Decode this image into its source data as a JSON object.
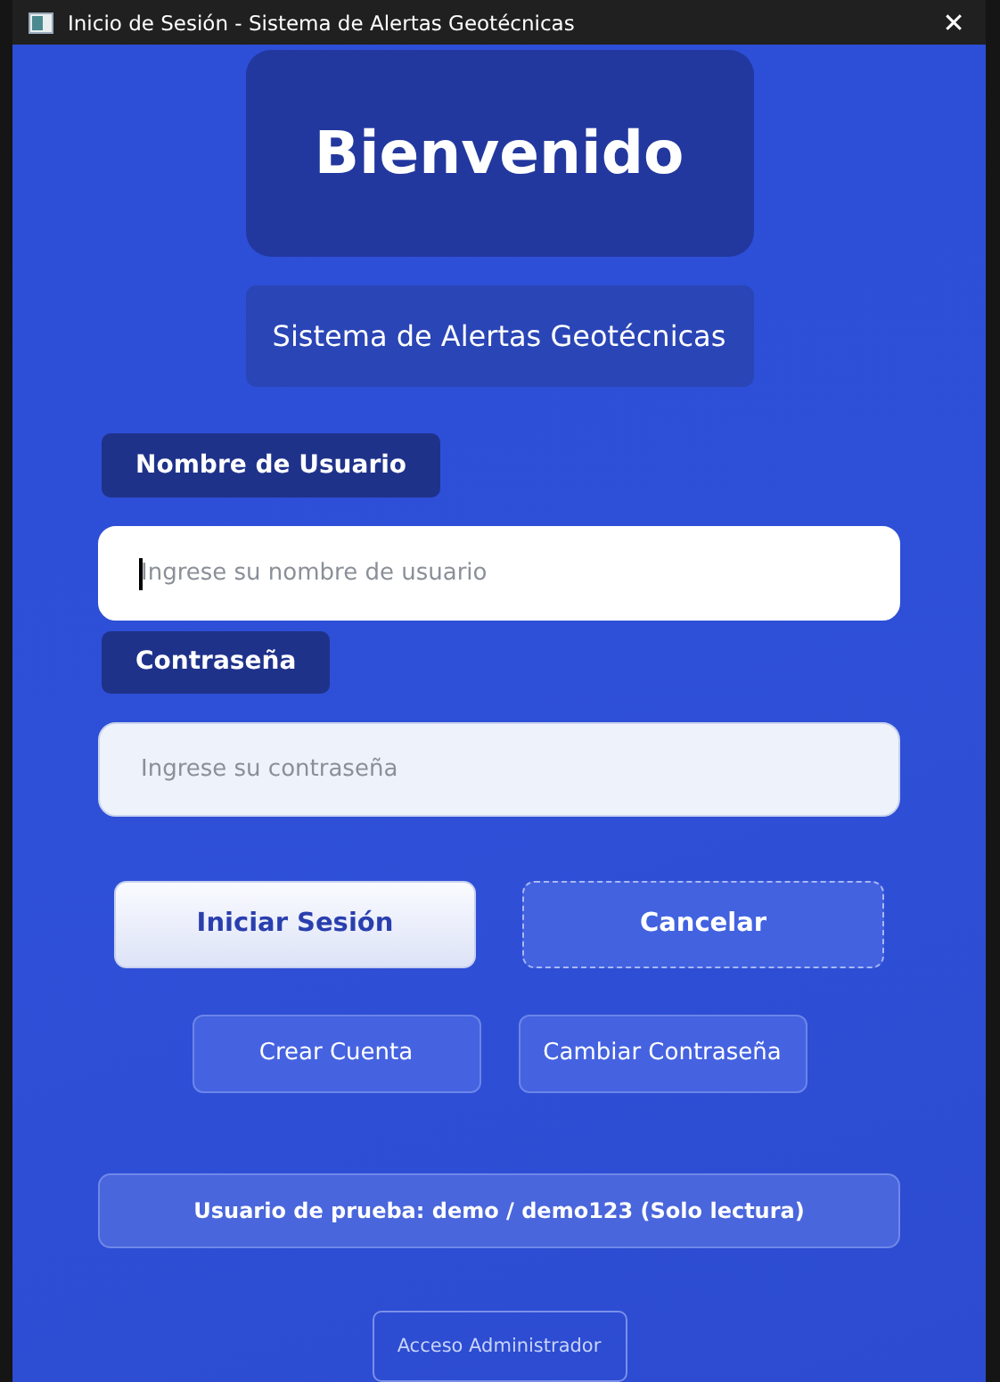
{
  "window": {
    "title": "Inicio de Sesión - Sistema de Alertas Geotécnicas",
    "close": "✕"
  },
  "header": {
    "title": "Bienvenido",
    "subtitle": "Sistema de Alertas Geotécnicas"
  },
  "fields": [
    {
      "label": "Nombre de Usuario",
      "placeholder": "Ingrese su nombre de usuario",
      "focused": true
    },
    {
      "label": "Contraseña",
      "placeholder": "Ingrese su contraseña",
      "focused": false
    }
  ],
  "primary_buttons": [
    {
      "label": "Iniciar Sesión",
      "kind": "primary"
    },
    {
      "label": "Cancelar",
      "kind": "secondary"
    }
  ],
  "secondary_buttons": [
    "Crear Cuenta",
    "Cambiar Contraseña"
  ],
  "info": "Usuario de prueba: demo / demo123 (Solo lectura)",
  "admin_button": "Acceso Administrador"
}
